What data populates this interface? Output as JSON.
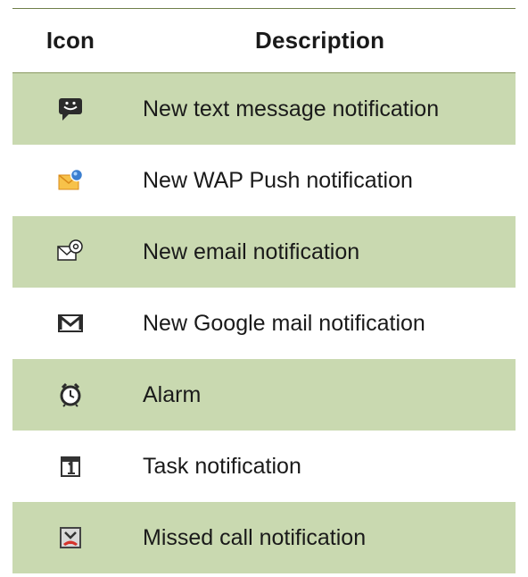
{
  "table": {
    "headers": {
      "icon": "Icon",
      "description": "Description"
    },
    "rows": [
      {
        "icon": "text-message-icon",
        "description": "New text message notification"
      },
      {
        "icon": "wap-push-icon",
        "description": "New WAP Push notification"
      },
      {
        "icon": "email-icon",
        "description": "New email notification"
      },
      {
        "icon": "google-mail-icon",
        "description": "New Google mail notification"
      },
      {
        "icon": "alarm-icon",
        "description": "Alarm"
      },
      {
        "icon": "task-icon",
        "description": "Task notification"
      },
      {
        "icon": "missed-call-icon",
        "description": "Missed call notification"
      }
    ]
  },
  "colors": {
    "shaded_row": "#c9d9b0",
    "rule": "#6f7f4a"
  }
}
